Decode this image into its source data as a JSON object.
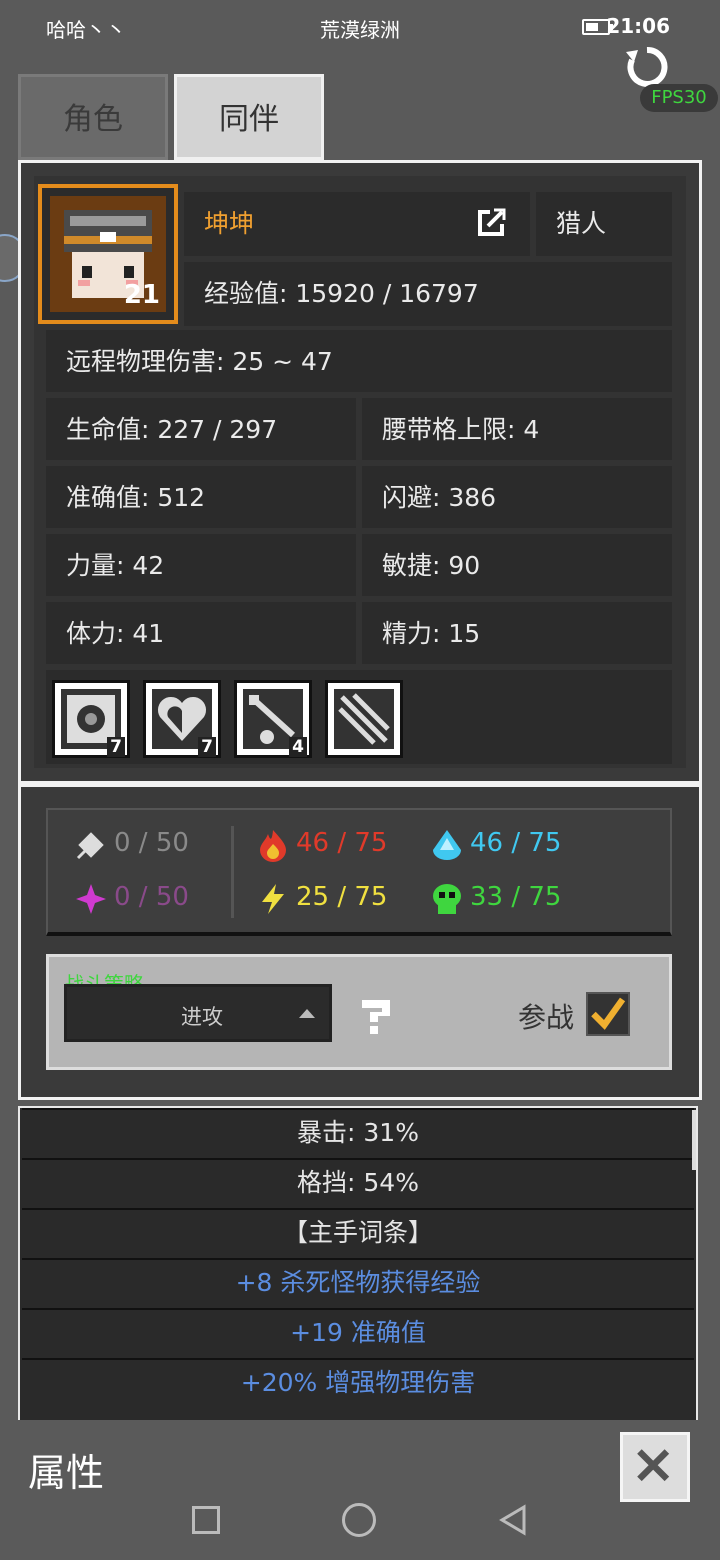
{
  "status_bar": {
    "carrier": "哈哈丶丶",
    "title": "荒漠绿洲",
    "time": "21:06"
  },
  "fps": "FPS30",
  "tabs": {
    "role": "角色",
    "companion": "同伴"
  },
  "companion": {
    "name": "坤坤",
    "class": "猎人",
    "level": "21",
    "exp": "经验值: 15920 / 16797",
    "damage": "远程物理伤害: 25 ~ 47",
    "stats": {
      "hp": "生命值: 227 / 297",
      "belt": "腰带格上限: 4",
      "accuracy": "准确值: 512",
      "dodge": "闪避: 386",
      "strength": "力量: 42",
      "agility": "敏捷: 90",
      "stamina": "体力: 41",
      "spirit": "精力: 15"
    },
    "skills": [
      {
        "icon": "target-skill-icon",
        "count": "7"
      },
      {
        "icon": "heart-skill-icon",
        "count": "7"
      },
      {
        "icon": "poison-arrow-skill-icon",
        "count": "4"
      },
      {
        "icon": "arrows-skill-icon",
        "count": ""
      }
    ]
  },
  "resistances": {
    "physical": "0 / 50",
    "arcane": "0 / 50",
    "fire": "46 / 75",
    "cold": "46 / 75",
    "lightning": "25 / 75",
    "poison": "33 / 75",
    "colors": {
      "dim": "#8a8a8a",
      "arcane": "#8a4a8a",
      "fire": "#e03a2a",
      "cold": "#40c8f0",
      "lightning": "#f0e040",
      "poison": "#3fd63f"
    }
  },
  "strategy": {
    "label": "战斗策略",
    "value": "进攻",
    "join_label": "参战"
  },
  "attributes": [
    {
      "text": "暴击: 31%",
      "color": "#e6e6e6"
    },
    {
      "text": "格挡: 54%",
      "color": "#e6e6e6"
    },
    {
      "text": "【主手词条】",
      "color": "#e6e6e6"
    },
    {
      "text": "+8 杀死怪物获得经验",
      "color": "#5b8de0"
    },
    {
      "text": "+19 准确值",
      "color": "#5b8de0"
    },
    {
      "text": "+20% 增强物理伤害",
      "color": "#5b8de0"
    }
  ],
  "footer": {
    "title": "属性"
  },
  "colors": {
    "name": "#f0a030",
    "accent_green": "#3fd63f"
  }
}
